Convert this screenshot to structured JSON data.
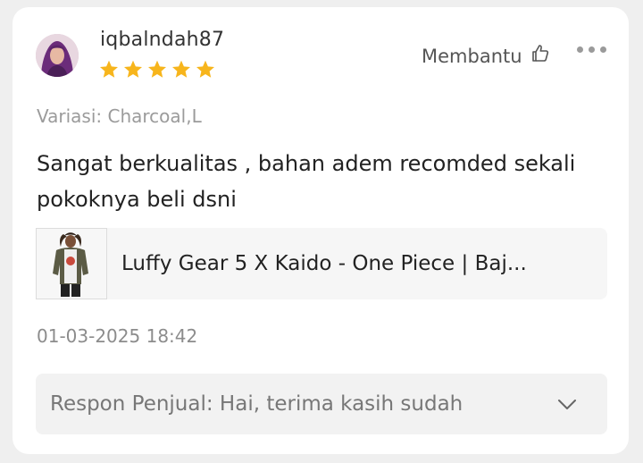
{
  "review": {
    "username": "iqbalndah87",
    "rating": 5,
    "rating_max": 5,
    "helpful_label": "Membantu",
    "variation": "Variasi: Charcoal,L",
    "text": "Sangat berkualitas , bahan adem recomded sekali pokoknya beli dsni",
    "timestamp": "01-03-2025 18:42"
  },
  "product": {
    "title": "Luffy Gear 5 X Kaido - One Piece | Baj..."
  },
  "seller_response": {
    "preview": "Respon Penjual: Hai, terima kasih sudah"
  },
  "icons": {
    "helpful": "thumbs-up-icon",
    "more": "more-options-icon",
    "expand": "chevron-down-icon",
    "star": "star-icon"
  },
  "colors": {
    "star": "#f7b51c",
    "card": "#ffffff",
    "panel": "#f2f2f2"
  }
}
